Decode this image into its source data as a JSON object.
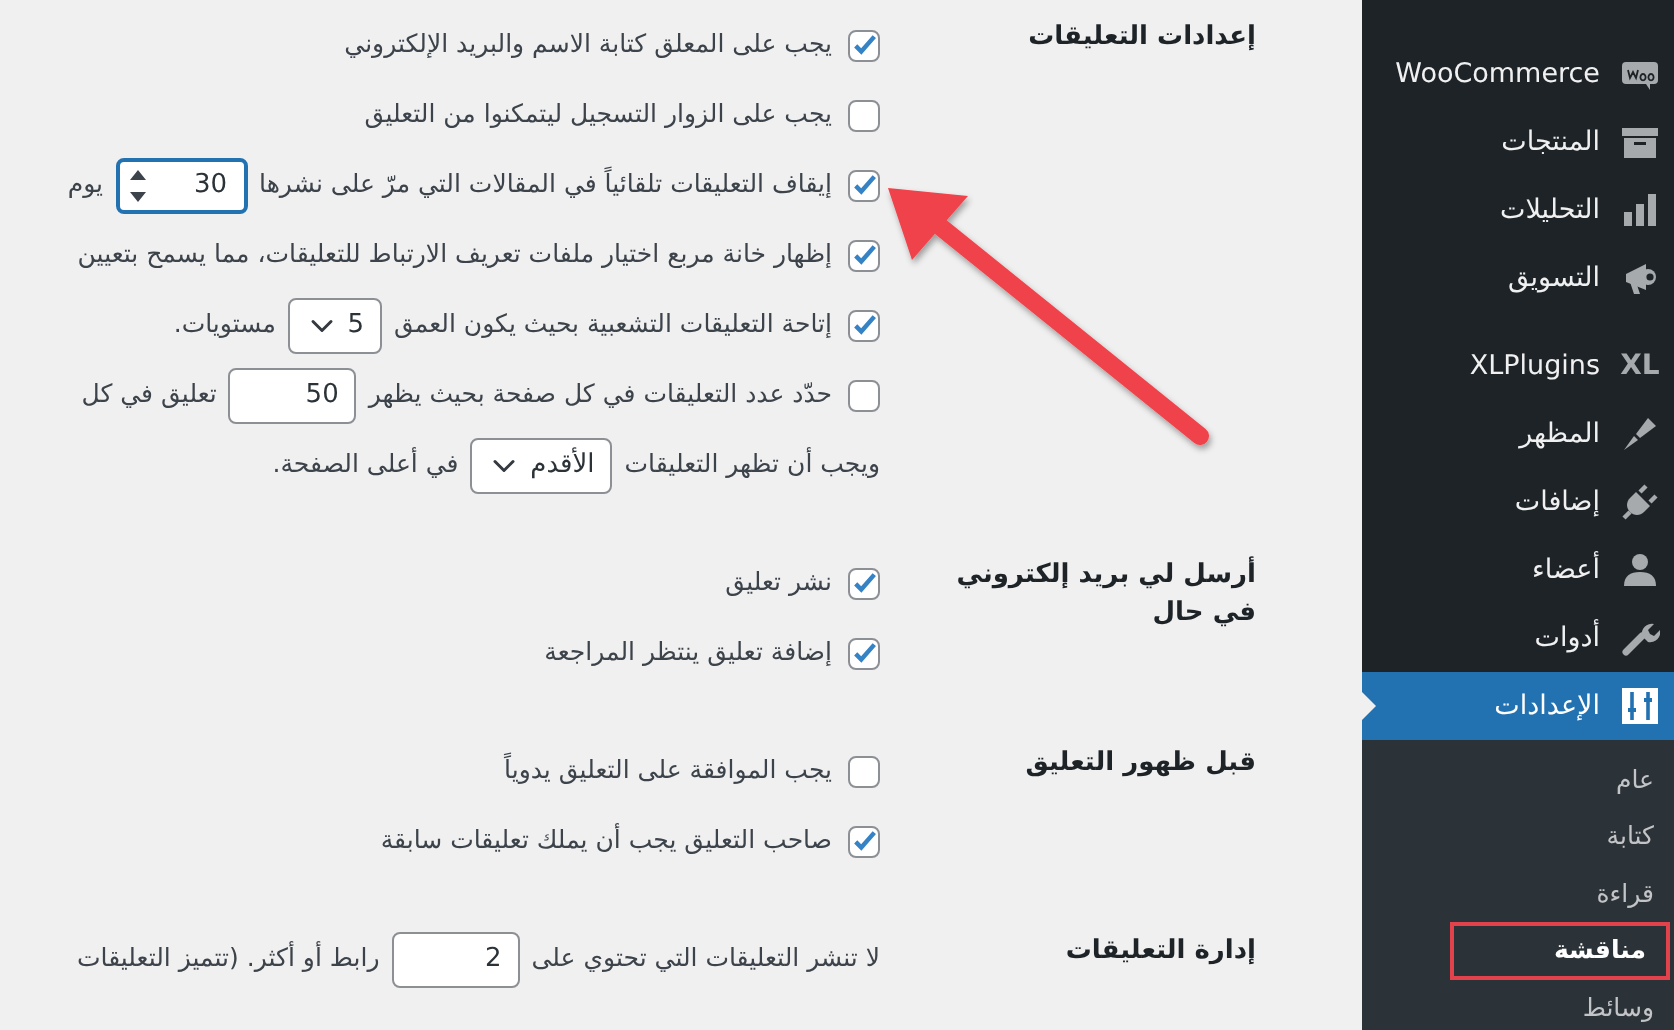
{
  "sidebar": {
    "menu_groups": [
      [
        {
          "label": "WooCommerce",
          "selected": false
        },
        {
          "label": "المنتجات",
          "selected": false
        },
        {
          "label": "التحليلات",
          "selected": false
        },
        {
          "label": "التسويق",
          "selected": false
        }
      ],
      [
        {
          "label": "XLPlugins",
          "icon_text": "XL",
          "selected": false
        },
        {
          "label": "المظهر",
          "selected": false
        },
        {
          "label": "إضافات",
          "selected": false
        },
        {
          "label": "أعضاء",
          "selected": false
        },
        {
          "label": "أدوات",
          "selected": false
        },
        {
          "label": "الإعدادات",
          "selected": true
        }
      ]
    ],
    "submenu": [
      {
        "label": "عام",
        "selected": false,
        "highlighted": false
      },
      {
        "label": "كتابة",
        "selected": false,
        "highlighted": false
      },
      {
        "label": "قراءة",
        "selected": false,
        "highlighted": false
      },
      {
        "label": "مناقشة",
        "selected": true,
        "highlighted": true
      },
      {
        "label": "وسائط",
        "selected": false,
        "highlighted": false
      }
    ]
  },
  "sections": [
    {
      "title": "إعدادات التعليقات",
      "options": [
        {
          "kind": "checkbox",
          "checked": true,
          "label": "يجب على المعلق كتابة الاسم والبريد الإلكتروني"
        },
        {
          "kind": "checkbox",
          "checked": false,
          "label": "يجب على الزوار التسجيل ليتمكنوا من التعليق"
        },
        {
          "kind": "checkbox_input",
          "checked": true,
          "before": "إيقاف التعليقات تلقائياً في المقالات التي مرّ على نشرها",
          "value": "30",
          "after": "يوم",
          "focused": true
        },
        {
          "kind": "checkbox",
          "checked": true,
          "label": "إظهار خانة مربع اختيار ملفات تعريف الارتباط للتعليقات، مما يسمح بتعيين"
        },
        {
          "kind": "checkbox_select",
          "checked": true,
          "before": "إتاحة التعليقات التشعبية بحيث يكون العمق",
          "value": "5",
          "after": "مستويات."
        },
        {
          "kind": "checkbox_input",
          "checked": false,
          "before": "حدّد عدد التعليقات في كل صفحة بحيث يظهر",
          "value": "50",
          "after": "تعليق في كل",
          "focused": false
        },
        {
          "kind": "select",
          "before": "ويجب أن تظهر التعليقات",
          "value": "الأقدم",
          "after": "في أعلى الصفحة."
        }
      ]
    },
    {
      "title": "أرسل لي بريد إلكتروني في حال",
      "options": [
        {
          "kind": "checkbox",
          "checked": true,
          "label": "نشر تعليق"
        },
        {
          "kind": "checkbox",
          "checked": true,
          "label": "إضافة تعليق ينتظر المراجعة"
        }
      ]
    },
    {
      "title": "قبل ظهور التعليق",
      "options": [
        {
          "kind": "checkbox",
          "checked": false,
          "label": "يجب الموافقة على التعليق يدوياً"
        },
        {
          "kind": "checkbox",
          "checked": true,
          "label": "صاحب التعليق يجب أن يملك تعليقات سابقة"
        }
      ]
    },
    {
      "title": "إدارة التعليقات",
      "options": [
        {
          "kind": "input",
          "before": "لا تنشر التعليقات التي تحتوي على",
          "value": "2",
          "after": "رابط أو أكثر. (تتميز التعليقات"
        }
      ]
    }
  ],
  "annotation": {
    "kind": "arrow"
  }
}
